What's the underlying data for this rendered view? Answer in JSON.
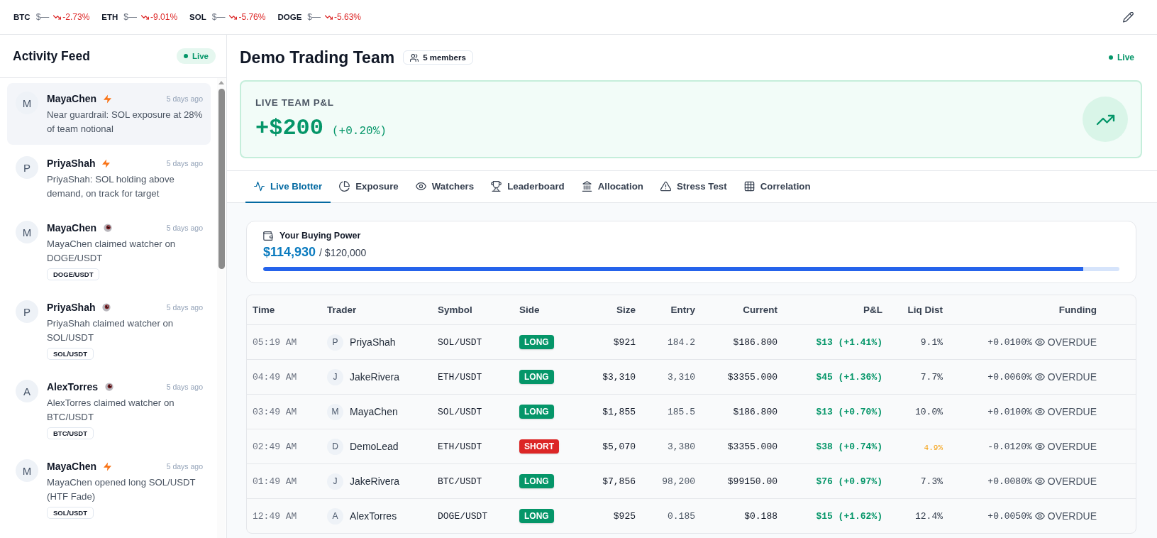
{
  "ticker": [
    {
      "symbol": "BTC",
      "price": "$—",
      "change": "-2.73%",
      "falling": true
    },
    {
      "symbol": "ETH",
      "price": "$—",
      "change": "-9.01%",
      "falling": true
    },
    {
      "symbol": "SOL",
      "price": "$—",
      "change": "-5.76%",
      "falling": true
    },
    {
      "symbol": "DOGE",
      "price": "$—",
      "change": "-5.63%",
      "falling": true
    }
  ],
  "activity_feed": {
    "title": "Activity Feed",
    "status": "Live",
    "items": [
      {
        "avatar": "M",
        "name": "MayaChen",
        "kind": "signal",
        "time": "5 days ago",
        "message": "Near guardrail: SOL exposure at 28% of team notional",
        "selected": true
      },
      {
        "avatar": "P",
        "name": "PriyaShah",
        "kind": "signal",
        "time": "5 days ago",
        "message": "PriyaShah: SOL holding above demand, on track for target",
        "selected": false
      },
      {
        "avatar": "M",
        "name": "MayaChen",
        "kind": "watcher",
        "time": "5 days ago",
        "message": "MayaChen claimed watcher on DOGE/USDT",
        "tag": "DOGE/USDT",
        "selected": false
      },
      {
        "avatar": "P",
        "name": "PriyaShah",
        "kind": "watcher",
        "time": "5 days ago",
        "message": "PriyaShah claimed watcher on SOL/USDT",
        "tag": "SOL/USDT",
        "selected": false
      },
      {
        "avatar": "A",
        "name": "AlexTorres",
        "kind": "watcher",
        "time": "5 days ago",
        "message": "AlexTorres claimed watcher on BTC/USDT",
        "tag": "BTC/USDT",
        "selected": false
      },
      {
        "avatar": "M",
        "name": "MayaChen",
        "kind": "signal",
        "time": "5 days ago",
        "message": "MayaChen opened long SOL/USDT (HTF Fade)",
        "tag": "SOL/USDT",
        "selected": false
      }
    ]
  },
  "team": {
    "name": "Demo Trading Team",
    "members": "5 members",
    "status": "Live"
  },
  "pnl_card": {
    "label": "LIVE TEAM P&L",
    "value": "+$200",
    "change": "(+0.20%)"
  },
  "tabs": [
    {
      "label": "Live Blotter",
      "selected": true
    },
    {
      "label": "Exposure",
      "selected": false
    },
    {
      "label": "Watchers",
      "selected": false
    },
    {
      "label": "Leaderboard",
      "selected": false
    },
    {
      "label": "Allocation",
      "selected": false
    },
    {
      "label": "Stress Test",
      "selected": false
    },
    {
      "label": "Correlation",
      "selected": false
    }
  ],
  "buying_power": {
    "title": "Your Buying Power",
    "available": "$114,930",
    "limit": "/ $120,000",
    "level": 0.958
  },
  "blotter": {
    "columns": [
      "Time",
      "Trader",
      "Symbol",
      "Side",
      "Size",
      "Entry",
      "Current",
      "P&L",
      "Liq Dist",
      "Funding"
    ],
    "rows": [
      {
        "time": "05:19 AM",
        "avatar": "P",
        "trader": "PriyaShah",
        "symbol": "SOL/USDT",
        "side": "LONG",
        "kind": "long",
        "size": "$921",
        "entry": "184.2",
        "current": "$186.800",
        "pnl": "$13 (+1.41%)",
        "liq_dist": "9.1%",
        "liq_warning": false,
        "funding": "+0.0100%",
        "funding_status": "OVERDUE"
      },
      {
        "time": "04:49 AM",
        "avatar": "J",
        "trader": "JakeRivera",
        "symbol": "ETH/USDT",
        "side": "LONG",
        "kind": "long",
        "size": "$3,310",
        "entry": "3,310",
        "current": "$3355.000",
        "pnl": "$45 (+1.36%)",
        "liq_dist": "7.7%",
        "liq_warning": false,
        "funding": "+0.0060%",
        "funding_status": "OVERDUE"
      },
      {
        "time": "03:49 AM",
        "avatar": "M",
        "trader": "MayaChen",
        "symbol": "SOL/USDT",
        "side": "LONG",
        "kind": "long",
        "size": "$1,855",
        "entry": "185.5",
        "current": "$186.800",
        "pnl": "$13 (+0.70%)",
        "liq_dist": "10.0%",
        "liq_warning": false,
        "funding": "+0.0100%",
        "funding_status": "OVERDUE"
      },
      {
        "time": "02:49 AM",
        "avatar": "D",
        "trader": "DemoLead",
        "symbol": "ETH/USDT",
        "side": "SHORT",
        "kind": "short",
        "size": "$5,070",
        "entry": "3,380",
        "current": "$3355.000",
        "pnl": "$38 (+0.74%)",
        "liq_dist": "4.9%",
        "liq_warning": true,
        "funding": "-0.0120%",
        "funding_status": "OVERDUE"
      },
      {
        "time": "01:49 AM",
        "avatar": "J",
        "trader": "JakeRivera",
        "symbol": "BTC/USDT",
        "side": "LONG",
        "kind": "long",
        "size": "$7,856",
        "entry": "98,200",
        "current": "$99150.00",
        "pnl": "$76 (+0.97%)",
        "liq_dist": "7.3%",
        "liq_warning": false,
        "funding": "+0.0080%",
        "funding_status": "OVERDUE"
      },
      {
        "time": "12:49 AM",
        "avatar": "A",
        "trader": "AlexTorres",
        "symbol": "DOGE/USDT",
        "side": "LONG",
        "kind": "long",
        "size": "$925",
        "entry": "0.185",
        "current": "$0.188",
        "pnl": "$15 (+1.62%)",
        "liq_dist": "12.4%",
        "liq_warning": false,
        "funding": "+0.0050%",
        "funding_status": "OVERDUE"
      }
    ]
  }
}
